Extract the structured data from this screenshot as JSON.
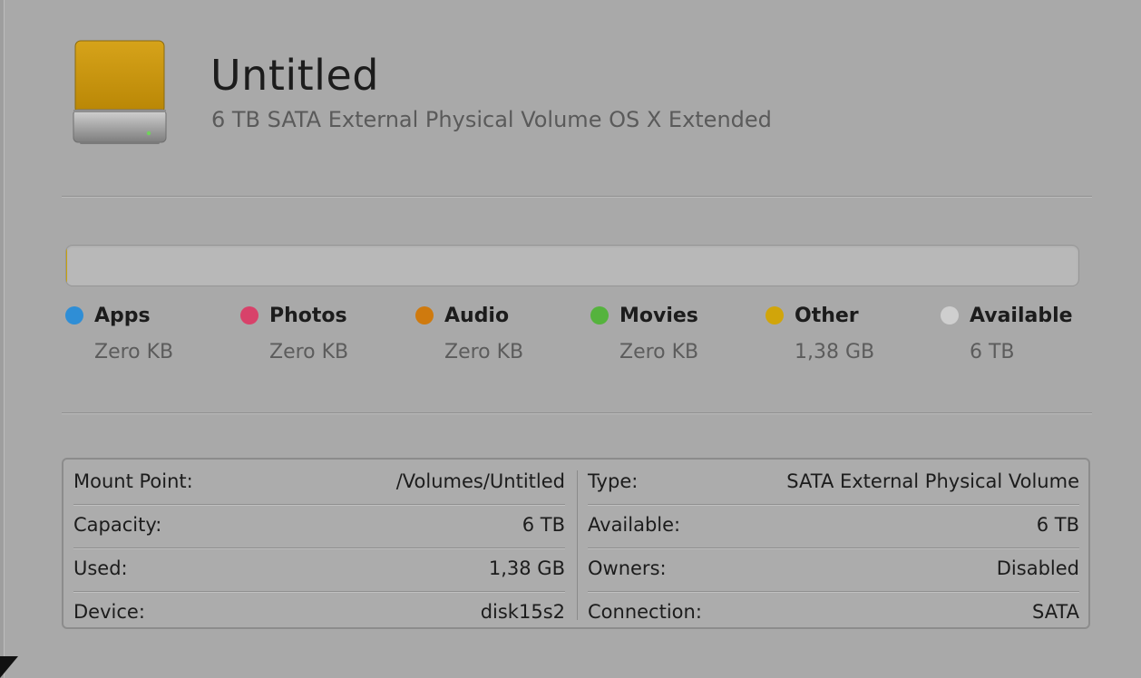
{
  "volume": {
    "name": "Untitled",
    "description": "6 TB SATA External Physical Volume OS X Extended"
  },
  "usage": {
    "used_fraction": 0.0002,
    "legend": [
      {
        "label": "Apps",
        "value": "Zero KB",
        "color": "#2f8ed6"
      },
      {
        "label": "Photos",
        "value": "Zero KB",
        "color": "#d8426a"
      },
      {
        "label": "Audio",
        "value": "Zero KB",
        "color": "#cf7a0e"
      },
      {
        "label": "Movies",
        "value": "Zero KB",
        "color": "#55b33d"
      },
      {
        "label": "Other",
        "value": "1,38 GB",
        "color": "#d1a50a"
      },
      {
        "label": "Available",
        "value": "6 TB",
        "color": "#cfcfcf"
      }
    ]
  },
  "info": {
    "left": [
      {
        "key": "Mount Point:",
        "value": "/Volumes/Untitled"
      },
      {
        "key": "Capacity:",
        "value": "6 TB"
      },
      {
        "key": "Used:",
        "value": "1,38 GB"
      },
      {
        "key": "Device:",
        "value": "disk15s2"
      }
    ],
    "right": [
      {
        "key": "Type:",
        "value": "SATA External Physical Volume"
      },
      {
        "key": "Available:",
        "value": "6 TB"
      },
      {
        "key": "Owners:",
        "value": "Disabled"
      },
      {
        "key": "Connection:",
        "value": "SATA"
      }
    ]
  },
  "icons": {
    "drive": "external-drive-icon"
  },
  "colors": {
    "background": "#a9a9a9",
    "drive_body": "#c7920f"
  }
}
